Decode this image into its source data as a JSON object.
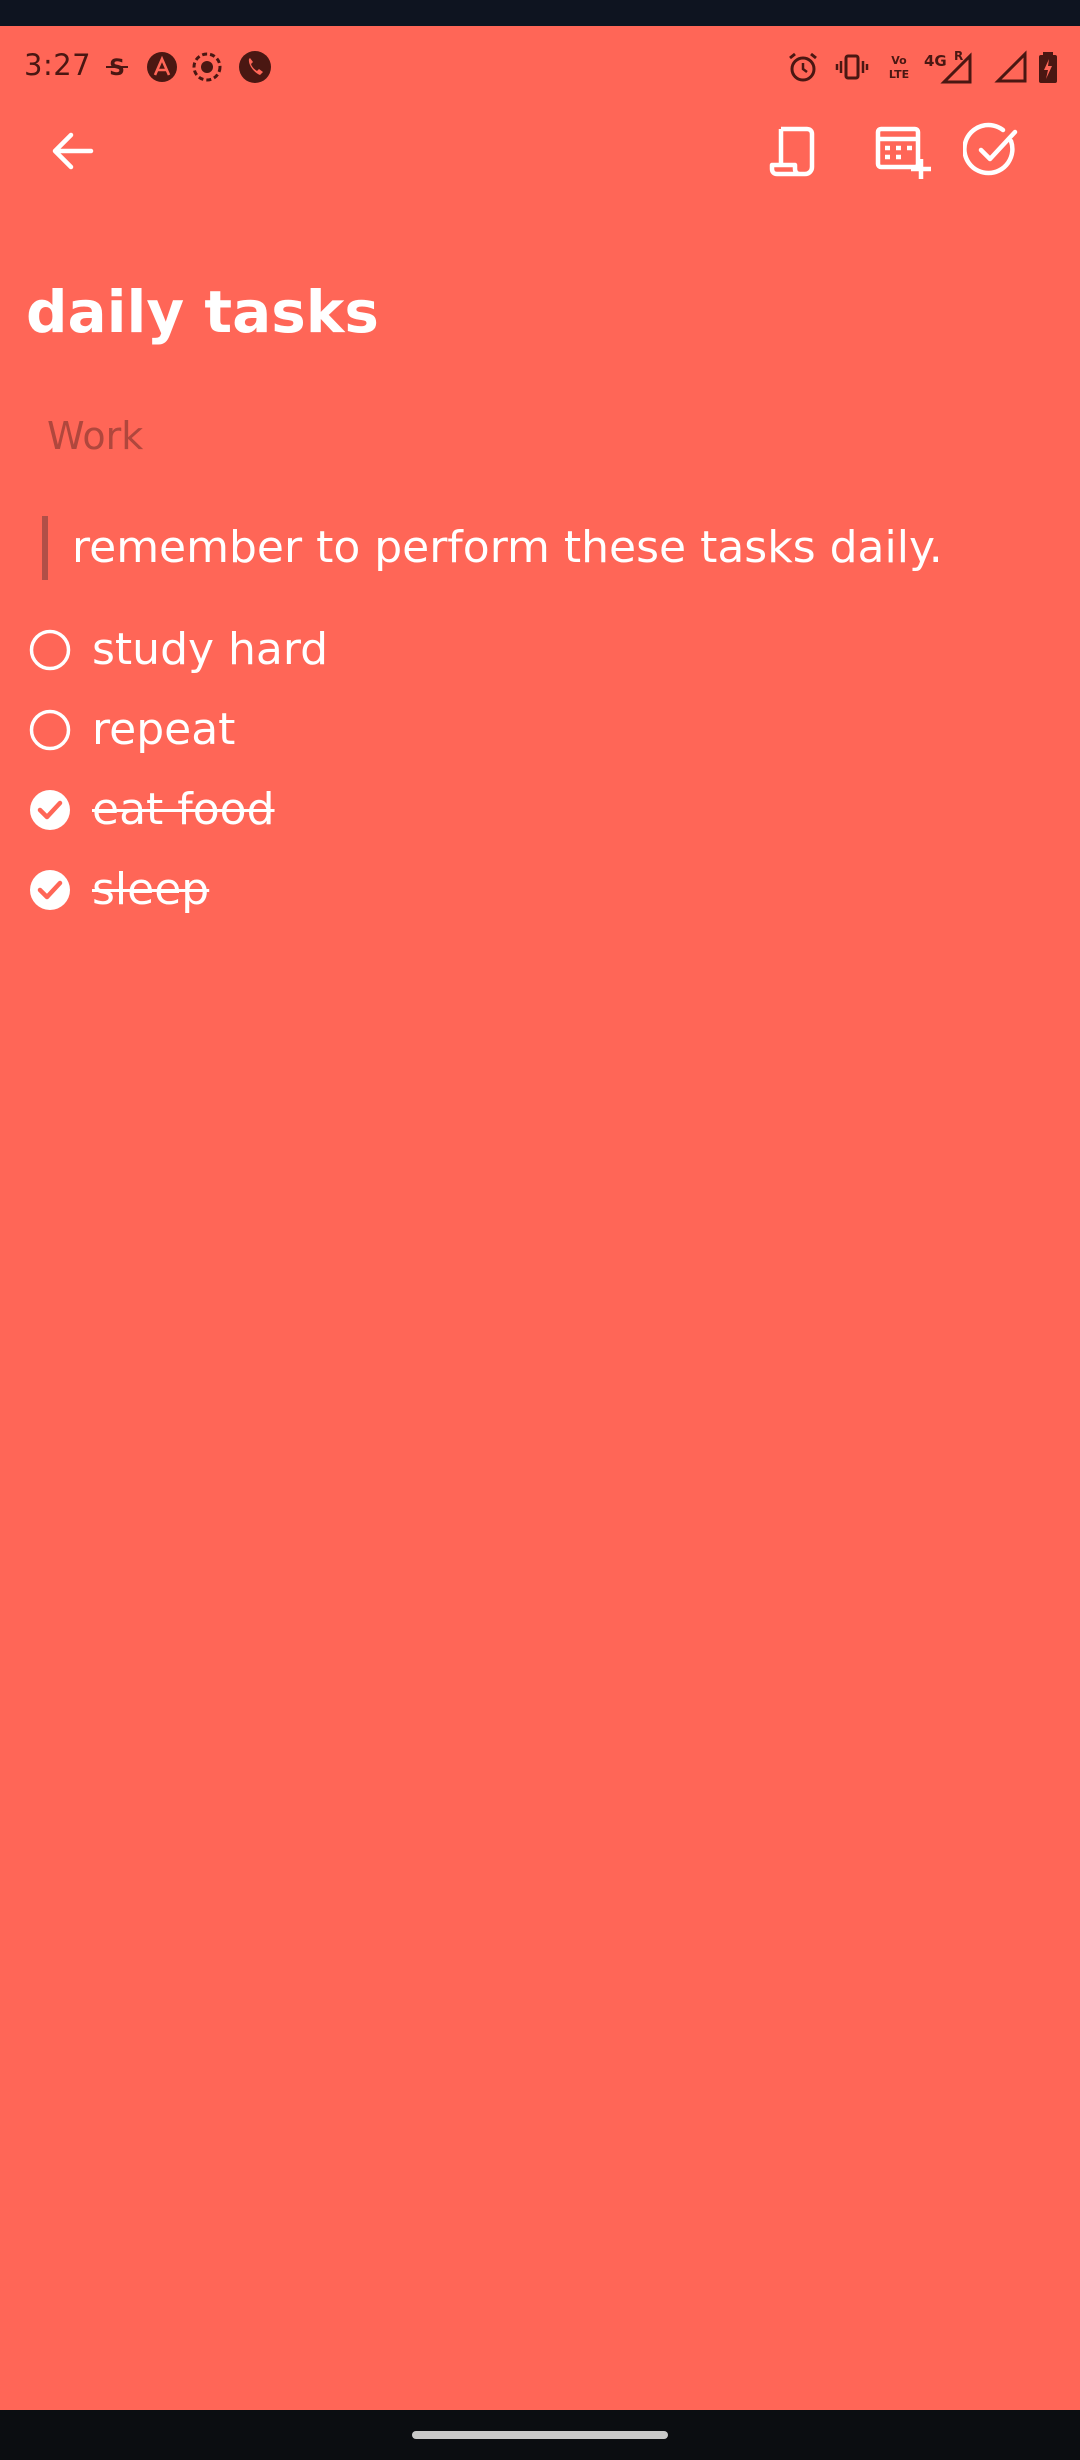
{
  "status_bar": {
    "time": "3:27",
    "left_icons": [
      "subscript-s-icon",
      "app-a-icon",
      "record-icon",
      "phone-call-icon"
    ],
    "right_icons": [
      "alarm-icon",
      "vibrate-icon",
      "volte-icon",
      "signal-4g-roaming-icon",
      "signal-icon",
      "battery-charging-icon"
    ],
    "volte_label": "Vo LTE",
    "network_label": "4G",
    "roaming_label": "R"
  },
  "toolbar": {
    "back_icon": "arrow-back-icon",
    "actions": [
      "scroll-note-icon",
      "add-to-calendar-icon",
      "mark-complete-icon"
    ]
  },
  "note": {
    "title": "daily tasks",
    "category_placeholder": "Work",
    "quote": "remember to perform these tasks daily."
  },
  "tasks": [
    {
      "label": "study hard",
      "checked": false
    },
    {
      "label": "repeat",
      "checked": false
    },
    {
      "label": "eat food",
      "checked": true
    },
    {
      "label": "sleep",
      "checked": true
    }
  ],
  "colors": {
    "background": "#FF6657",
    "text": "#FFFFFF",
    "muted": "#B0473D",
    "status_icons": "#4A1712"
  }
}
